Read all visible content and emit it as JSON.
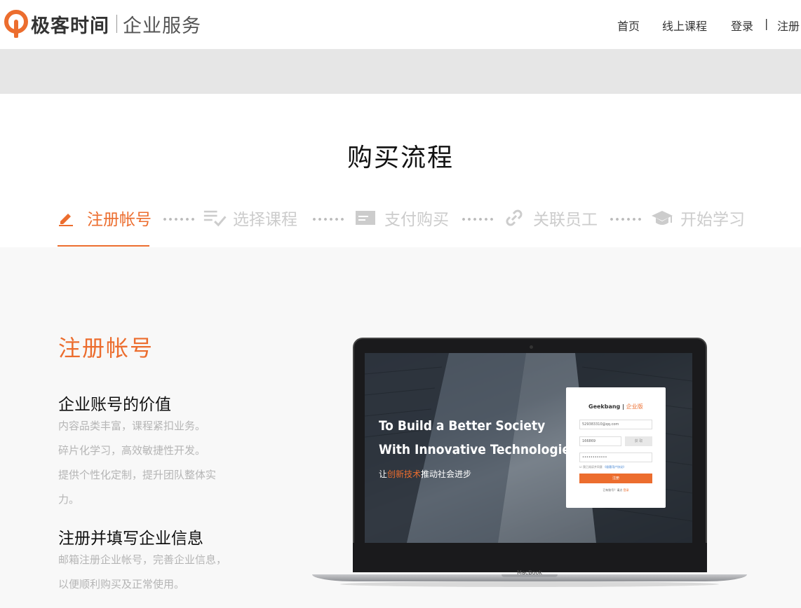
{
  "header": {
    "logo_name": "极客时间",
    "logo_sub": "企业服务",
    "nav": [
      "首页",
      "线上课程",
      "登录",
      "|",
      "注册"
    ]
  },
  "process": {
    "title": "购买流程",
    "steps": [
      {
        "label": "注册帐号",
        "icon": "pencil-icon",
        "active": true
      },
      {
        "label": "选择课程",
        "icon": "list-check-icon",
        "active": false
      },
      {
        "label": "支付购买",
        "icon": "card-icon",
        "active": false
      },
      {
        "label": "关联员工",
        "icon": "link-icon",
        "active": false
      },
      {
        "label": "开始学习",
        "icon": "graduation-cap-icon",
        "active": false
      }
    ]
  },
  "detail": {
    "heading": "注册帐号",
    "blocks": [
      {
        "title": "企业账号的价值",
        "lines": [
          "内容品类丰富，课程紧扣业务。",
          "碎片化学习，高效敏捷性开发。",
          "提供个性化定制，提升团队整体实",
          "力。"
        ]
      },
      {
        "title": "注册并填写企业信息",
        "lines": [
          "邮箱注册企业帐号，完善企业信息，",
          "以便顺利购买及正常使用。"
        ]
      }
    ]
  },
  "laptop": {
    "slogan_line1": "To Build a Better Society",
    "slogan_line2": "With Innovative Technologies",
    "slogan_cn_pre": "让",
    "slogan_cn_hl": "创新技术",
    "slogan_cn_post": "推动社会进步",
    "card_logo": "Geekbang",
    "card_logo_ent": "企业版",
    "field_email": "529383310@qq.com",
    "field_code": "166869",
    "code_button": "获 取",
    "field_password": "••••••••••••",
    "agree_text": "我已阅读并同意",
    "agree_link": "《极客用户协议》",
    "register_button": "注册",
    "login_prompt": "已有账号？请点",
    "login_link": "登录",
    "brand": "MacBook"
  },
  "colors": {
    "accent": "#ec6d2e",
    "muted": "#cccccc",
    "strip": "#e6e6e6"
  }
}
